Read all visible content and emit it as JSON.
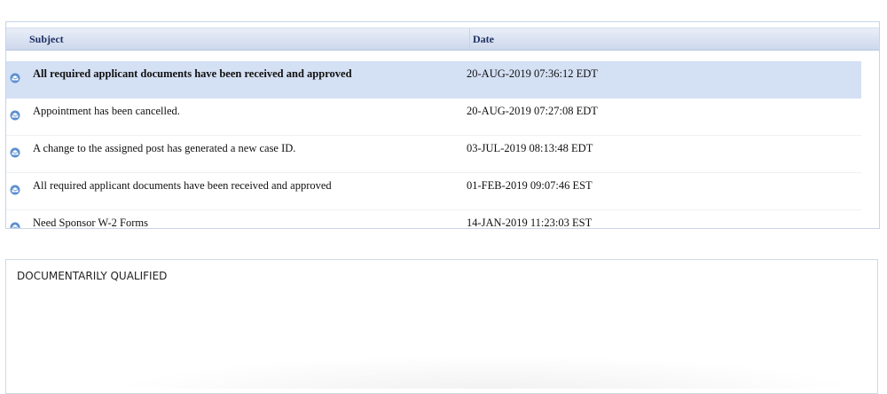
{
  "messages_table": {
    "columns": {
      "subject": "Subject",
      "date": "Date"
    },
    "rows": [
      {
        "subject": "All required applicant documents have been received and approved",
        "date": "20-AUG-2019 07:36:12 EDT",
        "selected": true,
        "icon": "envelope-open-icon"
      },
      {
        "subject": "Appointment has been cancelled.",
        "date": "20-AUG-2019 07:27:08 EDT",
        "selected": false,
        "icon": "envelope-open-icon"
      },
      {
        "subject": "A change to the assigned post has generated a new case ID.",
        "date": "03-JUL-2019 08:13:48 EDT",
        "selected": false,
        "icon": "envelope-open-icon"
      },
      {
        "subject": "All required applicant documents have been received and approved",
        "date": "01-FEB-2019 09:07:46 EST",
        "selected": false,
        "icon": "envelope-open-icon"
      },
      {
        "subject": "Need Sponsor W-2 Forms",
        "date": "14-JAN-2019 11:23:03 EST",
        "selected": false,
        "icon": "envelope-open-icon"
      }
    ]
  },
  "message_detail": {
    "body": "DOCUMENTARILY QUALIFIED"
  },
  "colors": {
    "header_text": "#1e2f64",
    "selected_row": "#d4e0f4",
    "icon_blue": "#5b8fd0"
  }
}
